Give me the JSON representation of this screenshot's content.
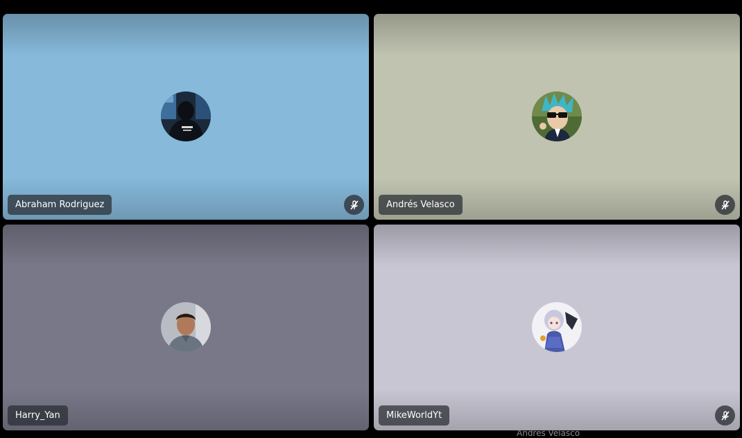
{
  "participants": [
    {
      "name": "Abraham Rodriguez",
      "background": "#86b9da",
      "avatar_icon": "person-hoodie-avatar",
      "muted": true,
      "mute_icon": "mic-off-icon"
    },
    {
      "name": "Andrés Velasco",
      "background": "#c0c3b0",
      "avatar_icon": "cartoon-scientist-avatar",
      "muted": true,
      "mute_icon": "mic-off-icon"
    },
    {
      "name": "Harry_Yan",
      "background": "#787889",
      "avatar_icon": "person-photo-avatar",
      "muted": false
    },
    {
      "name": "MikeWorldYt",
      "background": "#c8c6d3",
      "avatar_icon": "anime-character-avatar",
      "muted": true,
      "mute_icon": "mic-off-icon"
    }
  ],
  "partial_caption": "Andrés Velasco"
}
